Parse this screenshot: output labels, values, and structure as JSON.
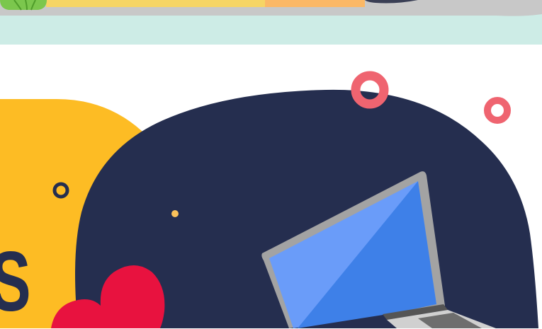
{
  "colors": {
    "top_band": "#cdece6",
    "shelf": "#c8c8c8",
    "book_yellow": "#f6d565",
    "book_orange": "#fbb866",
    "plant_green": "#7bc74d",
    "yellow_blob": "#fdbc24",
    "navy_blob": "#252e4f",
    "ring_coral": "#ef6470",
    "dot_yellow": "#fbc25b",
    "heart_red": "#e8123f",
    "laptop_screen": "#6a9cf9",
    "laptop_screen_shade": "#3e80e8",
    "laptop_frame": "#9a9a9a",
    "laptop_keyboard": "#6e6e6e"
  },
  "hero": {
    "partial_letter": "S"
  },
  "icons": [
    "plant-icon",
    "heart-icon",
    "laptop-icon",
    "ring-icon",
    "dot-icon"
  ]
}
